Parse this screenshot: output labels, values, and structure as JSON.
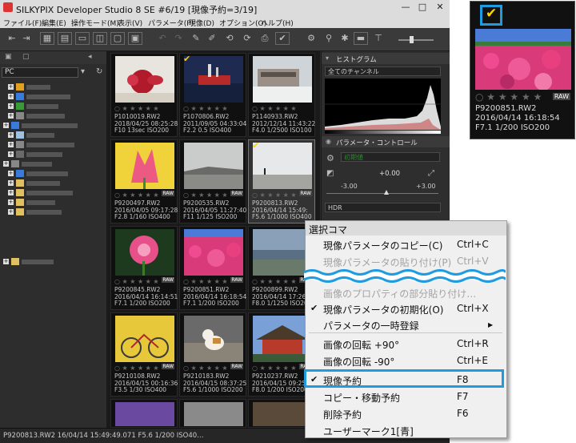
{
  "window": {
    "title": "SILKYPIX Developer Studio 8 SE    #6/19 [現像予約=3/19]",
    "minimize": "—",
    "maximize": "□",
    "close": "✕"
  },
  "menu": [
    "ファイル(F)",
    "編集(E)",
    "操作モード(M)",
    "表示(V)",
    "パラメータ(P)",
    "現像(D)",
    "オプション(O)",
    "ヘルプ(H)"
  ],
  "sidebar": {
    "location": "PC"
  },
  "thumbnails": [
    {
      "name": "P1010019.RW2",
      "date": "2018/04/25 08:25:28",
      "exif": "F10 13sec ISO200",
      "checked": false,
      "raw": false,
      "selected": false
    },
    {
      "name": "P1070806.RW2",
      "date": "2011/09/05 04:33:04",
      "exif": "F2.2 0.5 ISO400",
      "checked": true,
      "raw": false,
      "selected": false
    },
    {
      "name": "P1140933.RW2",
      "date": "2012/12/14 11:43:22",
      "exif": "F4.0 1/2500 ISO100",
      "checked": false,
      "raw": false,
      "selected": false
    },
    {
      "name": "P9200497.RW2",
      "date": "2016/04/05 09:17:28",
      "exif": "F2.8 1/160 ISO400",
      "checked": true,
      "raw": true,
      "selected": false
    },
    {
      "name": "P9200535.RW2",
      "date": "2016/04/05 11:27:40",
      "exif": "F11 1/125 ISO200",
      "checked": false,
      "raw": true,
      "selected": false
    },
    {
      "name": "P9200813.RW2",
      "date": "2016/04/14 15:49:",
      "exif": "F5.6 1/1000 ISO400",
      "checked": true,
      "raw": true,
      "selected": true
    },
    {
      "name": "P9200845.RW2",
      "date": "2016/04/14 16:14:51",
      "exif": "F7.1 1/200 ISO200",
      "checked": false,
      "raw": true,
      "selected": false
    },
    {
      "name": "P9200851.RW2",
      "date": "2016/04/14 16:18:54",
      "exif": "F7.1 1/200 ISO200",
      "checked": false,
      "raw": true,
      "selected": false
    },
    {
      "name": "P9200899.RW2",
      "date": "2016/04/14 17:26:06",
      "exif": "F8.0 1/1250 ISO200",
      "checked": false,
      "raw": true,
      "selected": false
    },
    {
      "name": "P9210108.RW2",
      "date": "2016/04/15 00:16:36",
      "exif": "F3.5 1/30 ISO400",
      "checked": false,
      "raw": true,
      "selected": false
    },
    {
      "name": "P9210183.RW2",
      "date": "2016/04/15 08:37:25",
      "exif": "F5.6 1/1000 ISO200",
      "checked": false,
      "raw": true,
      "selected": false
    },
    {
      "name": "P9210237.RW2",
      "date": "2016/04/15 09:25:51",
      "exif": "F8.0 1/200 ISO200",
      "checked": false,
      "raw": true,
      "selected": false
    }
  ],
  "raw_badge": "RAW",
  "stars": "○ ★ ★ ★ ★ ★",
  "check_mark": "✔",
  "panels": {
    "histogram": {
      "title": "ヒストグラム",
      "channel": "全てのチャンネル"
    },
    "control": {
      "title": "パラメータ・コントロール",
      "preset": "初期値",
      "exposure": "+0.00",
      "min": "-3.00",
      "max": "+3.00",
      "hdr": "HDR"
    }
  },
  "status_bar": "P9200813.RW2 16/04/14 15:49:49.071 F5.6 1/200 ISO40…",
  "context_menu": {
    "header": "選択コマ",
    "items": [
      {
        "label": "現像パラメータのコピー(C)",
        "shortcut": "Ctrl+C",
        "checked": false,
        "disabled": false
      },
      {
        "label": "現像パラメータの貼り付け(P)",
        "shortcut": "Ctrl+V",
        "checked": false,
        "disabled": true
      },
      {
        "label": "画像のプロパティの部分貼り付け…",
        "shortcut": "",
        "checked": false,
        "disabled": true
      },
      {
        "label": "現像パラメータの初期化(O)",
        "shortcut": "Ctrl+X",
        "checked": true,
        "disabled": false
      },
      {
        "label": "パラメータの一時登録",
        "shortcut": "",
        "checked": false,
        "disabled": false,
        "submenu": true
      },
      {
        "label": "画像の回転 +90°",
        "shortcut": "Ctrl+R",
        "checked": false,
        "disabled": false
      },
      {
        "label": "画像の回転 -90°",
        "shortcut": "Ctrl+E",
        "checked": false,
        "disabled": false
      },
      {
        "label": "現像予約",
        "shortcut": "F8",
        "checked": true,
        "disabled": false
      },
      {
        "label": "コピー・移動予約",
        "shortcut": "F7",
        "checked": false,
        "disabled": false
      },
      {
        "label": "削除予約",
        "shortcut": "F6",
        "checked": false,
        "disabled": false
      },
      {
        "label": "ユーザーマーク1[青]",
        "shortcut": "",
        "checked": false,
        "disabled": false
      }
    ],
    "submenu_arrow": "▶"
  },
  "inset": {
    "name": "P9200851.RW2",
    "date": "2016/04/14 16:18:54",
    "exif": "F7.1 1/200 ISO200",
    "stars": "○ ★ ★ ★ ★ ★",
    "raw": "RAW",
    "check": "✔"
  },
  "colors": {
    "highlight": "#1f9be0",
    "check": "#ffd400"
  }
}
